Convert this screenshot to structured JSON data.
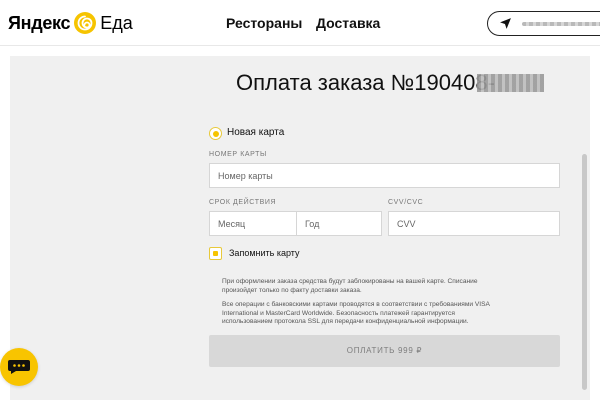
{
  "header": {
    "logo_yandex": "Яндекс",
    "logo_eda": "Еда",
    "nav": {
      "restaurants": "Рестораны",
      "delivery": "Доставка"
    }
  },
  "main": {
    "title": "Оплата заказа №190408-"
  },
  "form": {
    "radio_label": "Новая карта",
    "card_number_label": "НОМЕР КАРТЫ",
    "card_number_placeholder": "Номер карты",
    "expiry_label": "СРОК ДЕЙСТВИЯ",
    "month_placeholder": "Месяц",
    "year_placeholder": "Год",
    "cvv_label": "CVV/CVC",
    "cvv_placeholder": "CVV",
    "remember_label": "Запомнить карту",
    "info_1_line_1": "При оформлении заказа средства будут заблокированы на вашей карте. Списание",
    "info_1_line_2": "произойдет только по факту доставки заказа.",
    "info_2_line_1": "Все операции с банковскими картами проводятся в соответствии с требованиями VISA",
    "info_2_line_2": "International и MasterCard Worldwide. Безопасность платежей гарантируется",
    "info_2_line_3": "использованием протокола SSL для передачи конфиденциальной информации.",
    "pay_button": "ОПЛАТИТЬ 999 ₽"
  },
  "colors": {
    "accent": "#f6c400",
    "page_background": "#f0f0f0",
    "button_disabled": "#d8d8d8"
  },
  "icons": {
    "logo": "eda-spiral-logo-icon",
    "address": "location-arrow-icon",
    "chat": "chat-bubble-icon"
  }
}
